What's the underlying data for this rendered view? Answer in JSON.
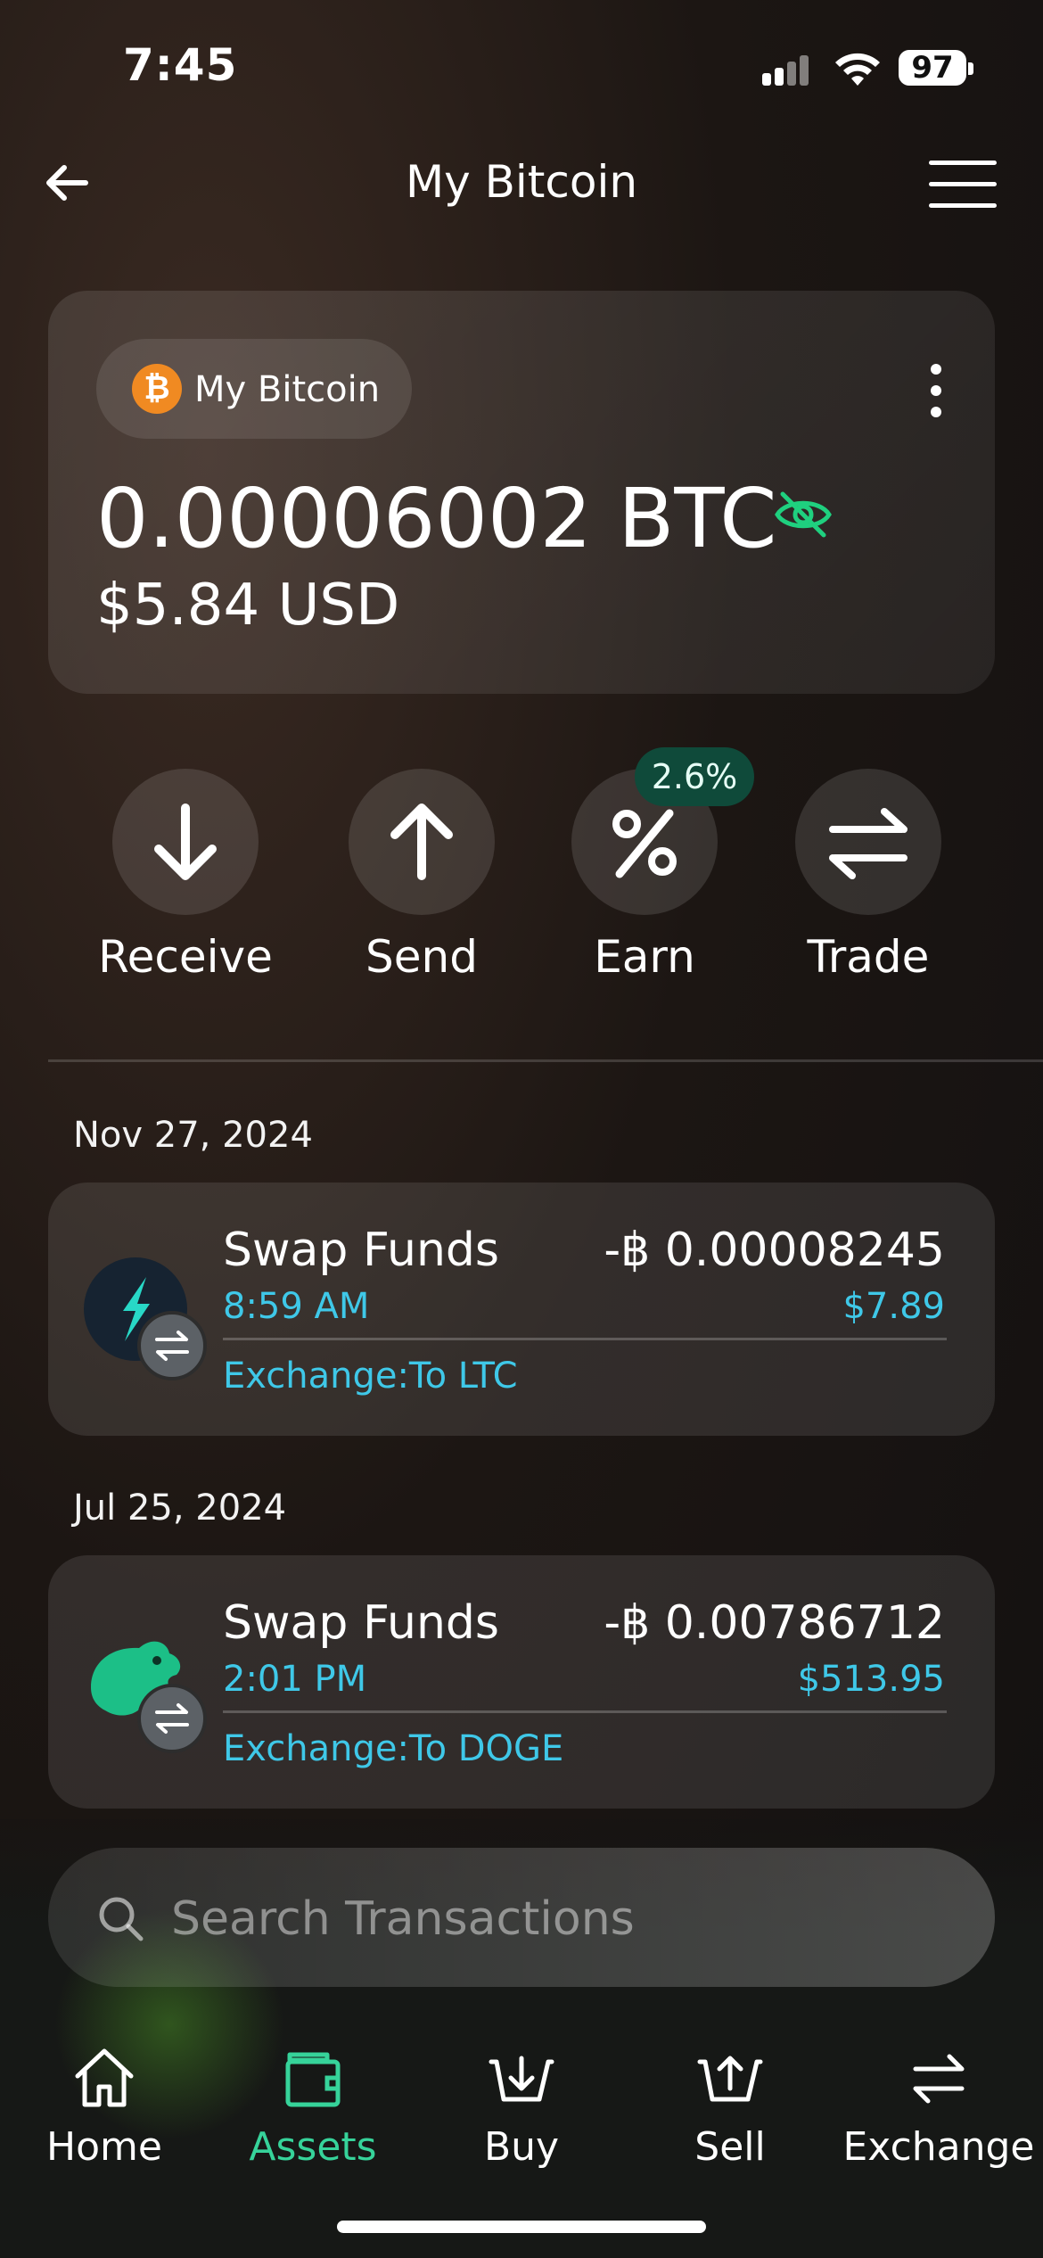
{
  "status_bar": {
    "time": "7:45",
    "battery": "97"
  },
  "header": {
    "title": "My Bitcoin"
  },
  "balance_card": {
    "asset_chip_label": "My Bitcoin",
    "btc_amount": "0.00006002 BTC",
    "usd_amount": "$5.84 USD"
  },
  "actions": [
    {
      "label": "Receive",
      "icon": "arrow-down-icon"
    },
    {
      "label": "Send",
      "icon": "arrow-up-icon"
    },
    {
      "label": "Earn",
      "icon": "percent-icon",
      "badge": "2.6%"
    },
    {
      "label": "Trade",
      "icon": "swap-arrows-icon"
    }
  ],
  "transactions": [
    {
      "date": "Nov 27, 2024",
      "title": "Swap Funds",
      "time": "8:59 AM",
      "amount": "-฿ 0.00008245",
      "usd": "$7.89",
      "detail": "Exchange:To LTC",
      "icon": "litecoin-icon"
    },
    {
      "date": "Jul 25, 2024",
      "title": "Swap Funds",
      "time": "2:01 PM",
      "amount": "-฿ 0.00786712",
      "usd": "$513.95",
      "detail": "Exchange:To DOGE",
      "icon": "dogecoin-icon"
    }
  ],
  "search": {
    "placeholder": "Search Transactions"
  },
  "bottom_nav": [
    {
      "label": "Home",
      "icon": "home-icon",
      "active": false
    },
    {
      "label": "Assets",
      "icon": "wallet-icon",
      "active": true
    },
    {
      "label": "Buy",
      "icon": "buy-basket-icon",
      "active": false
    },
    {
      "label": "Sell",
      "icon": "sell-basket-icon",
      "active": false
    },
    {
      "label": "Exchange",
      "icon": "exchange-icon",
      "active": false
    }
  ],
  "colors": {
    "accent": "#3fc8e8",
    "active_nav": "#36d39a",
    "bitcoin": "#f08a22",
    "eye_icon": "#1fd07f"
  }
}
